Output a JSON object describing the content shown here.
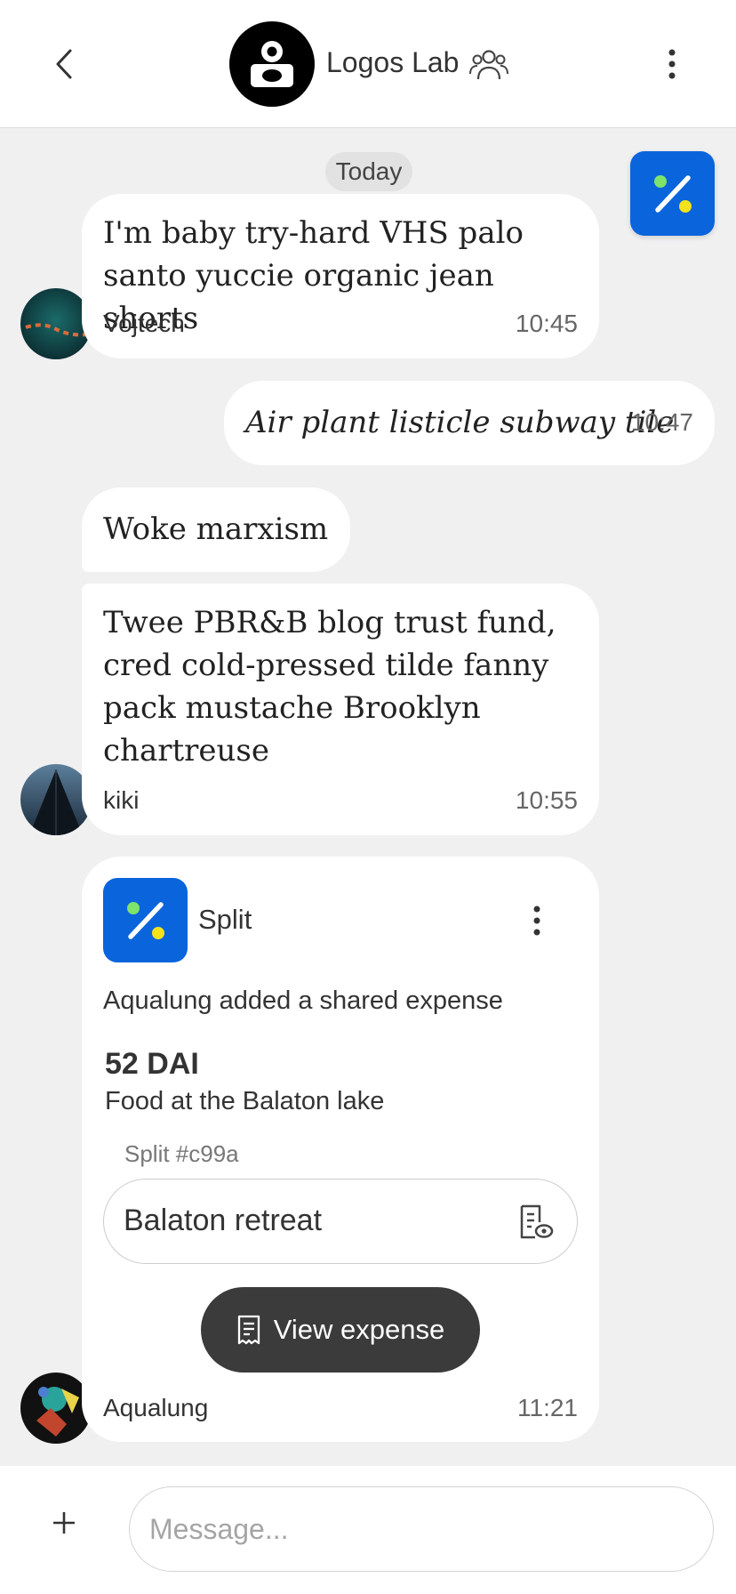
{
  "header": {
    "title": "Logos Lab",
    "back_icon": "chevron-left-icon",
    "group_icon": "users-icon",
    "more_icon": "more-vertical-icon"
  },
  "day_separator": "Today",
  "fab": {
    "icon": "percent-icon",
    "color": "#0a64dc"
  },
  "messages": [
    {
      "text": "I'm baby try-hard VHS palo santo yuccie organic jean shorts",
      "sender": "Vojtech",
      "time": "10:45",
      "incoming": true
    },
    {
      "text": "Air plant listicle subway tile",
      "time": "10:47",
      "incoming": false
    },
    {
      "text": "Woke marxism",
      "incoming": true
    },
    {
      "text": "Twee PBR&B blog trust fund, cred cold-pressed tilde fanny pack mustache Brooklyn chartreuse",
      "sender": "kiki",
      "time": "10:55",
      "incoming": true
    }
  ],
  "split_card": {
    "app_name": "Split",
    "description": "Aqualung added a shared expense",
    "amount": "52 DAI",
    "subtitle": "Food at the Balaton lake",
    "split_id": "Split #c99a",
    "group_name": "Balaton retreat",
    "view_button": "View expense",
    "sender": "Aqualung",
    "time": "11:21"
  },
  "composer": {
    "placeholder": "Message..."
  },
  "colors": {
    "brand_blue": "#0a64dc",
    "accent_green": "#7ee36b",
    "accent_yellow": "#f4e21a",
    "dark_button": "#3b3b3b"
  }
}
